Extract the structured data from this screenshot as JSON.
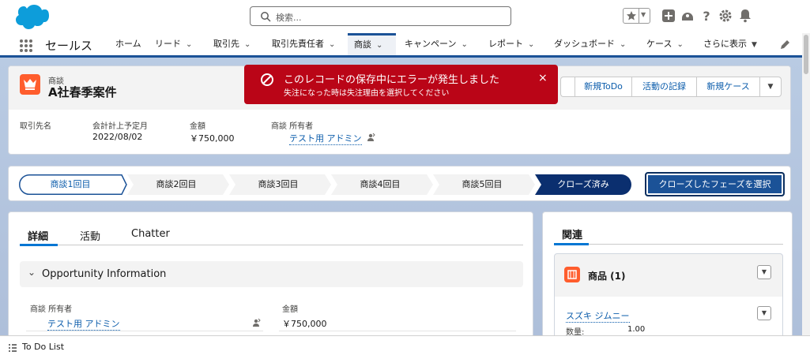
{
  "header": {
    "search_placeholder": "検索...",
    "icons": [
      "star-icon",
      "add-icon",
      "setup-assistant-icon",
      "help-icon",
      "gear-icon",
      "bell-icon"
    ]
  },
  "nav": {
    "app_name": "セールス",
    "items": [
      {
        "label": "ホーム",
        "chevron": false
      },
      {
        "label": "リード",
        "chevron": true
      },
      {
        "label": "取引先",
        "chevron": true
      },
      {
        "label": "取引先責任者",
        "chevron": true
      },
      {
        "label": "商談",
        "chevron": true,
        "active": true
      },
      {
        "label": "キャンペーン",
        "chevron": true
      },
      {
        "label": "レポート",
        "chevron": true
      },
      {
        "label": "ダッシュボード",
        "chevron": true
      },
      {
        "label": "ケース",
        "chevron": true
      },
      {
        "label": "さらに表示",
        "chevron": true
      }
    ]
  },
  "record": {
    "type": "商談",
    "name": "A社春季案件",
    "buttons": [
      "新規ToDo",
      "活動の記録",
      "新規ケース"
    ],
    "fields": [
      {
        "label": "取引先名",
        "value": ""
      },
      {
        "label": "会計計上予定月",
        "value": "2022/08/02"
      },
      {
        "label": "金額",
        "value": "￥750,000"
      },
      {
        "label": "商談 所有者",
        "value": "テスト用 アドミン"
      }
    ]
  },
  "toast": {
    "title": "このレコードの保存中にエラーが発生しました",
    "message": "失注になった時は失注理由を選択してください",
    "close": "×"
  },
  "path": {
    "stages": [
      "商談1回目",
      "商談2回目",
      "商談3回目",
      "商談4回目",
      "商談5回目",
      "クローズ済み"
    ],
    "current_index": 0,
    "select_button": "クローズしたフェーズを選択"
  },
  "detail": {
    "tabs": [
      "詳細",
      "活動",
      "Chatter"
    ],
    "section_title": "Opportunity Information",
    "owner_label": "商談 所有者",
    "owner_value": "テスト用 アドミン",
    "amount_label": "金額",
    "amount_value": "￥750,000"
  },
  "related": {
    "title": "関連",
    "products_title": "商品 (1)",
    "product_name": "スズキ ジムニー",
    "qty_label": "数量:",
    "qty_value": "1.00"
  },
  "utility": {
    "todo_label": "To Do List"
  },
  "colors": {
    "brand_blue": "#1b5297",
    "link_blue": "#0b5cab",
    "error_red": "#ba0517",
    "opportunity_orange": "#ff5d2d"
  }
}
